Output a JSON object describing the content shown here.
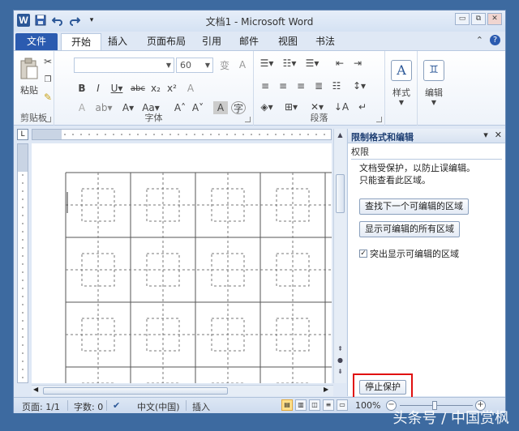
{
  "titlebar": {
    "title": "文档1 - Microsoft Word",
    "app_logo": "W",
    "icons": [
      "word-logo-icon",
      "save-icon",
      "undo-icon",
      "redo-icon",
      "customize-qat-icon"
    ],
    "win_minimize": "▭",
    "win_restore": "⧉",
    "win_close": "✕"
  },
  "tabs": {
    "file": "文件",
    "items": [
      "开始",
      "插入",
      "页面布局",
      "引用",
      "邮件",
      "视图",
      "书法"
    ],
    "active_index": 0
  },
  "ribbon": {
    "clipboard": {
      "label": "剪贴板",
      "paste": "粘贴"
    },
    "font": {
      "label": "字体",
      "font_name": "",
      "font_size": "60"
    },
    "paragraph": {
      "label": "段落"
    },
    "styles": {
      "label": "样式"
    },
    "editing": {
      "label": "编辑"
    }
  },
  "pane": {
    "title": "限制格式和编辑",
    "section": "权限",
    "desc_line1": "文档受保护，以防止误编辑。",
    "desc_line2": "只能查看此区域。",
    "find_next_button": "查找下一个可编辑的区域",
    "show_all_button": "显示可编辑的所有区域",
    "highlight_checkbox": "突出显示可编辑的区域",
    "highlight_checked": true,
    "stop_protection_button": "停止保护",
    "dropdown_glyph": "▾",
    "close_glyph": "✕"
  },
  "status": {
    "page": "页面: 1/1",
    "words": "字数: 0",
    "language": "中文(中国)",
    "mode": "插入",
    "zoom": "100%"
  },
  "watermark": "头条号 / 中国赏枫",
  "colors": {
    "desktop": "#3d6aa0",
    "file_tab": "#2b5bb0",
    "highlight_border": "#e01010"
  }
}
